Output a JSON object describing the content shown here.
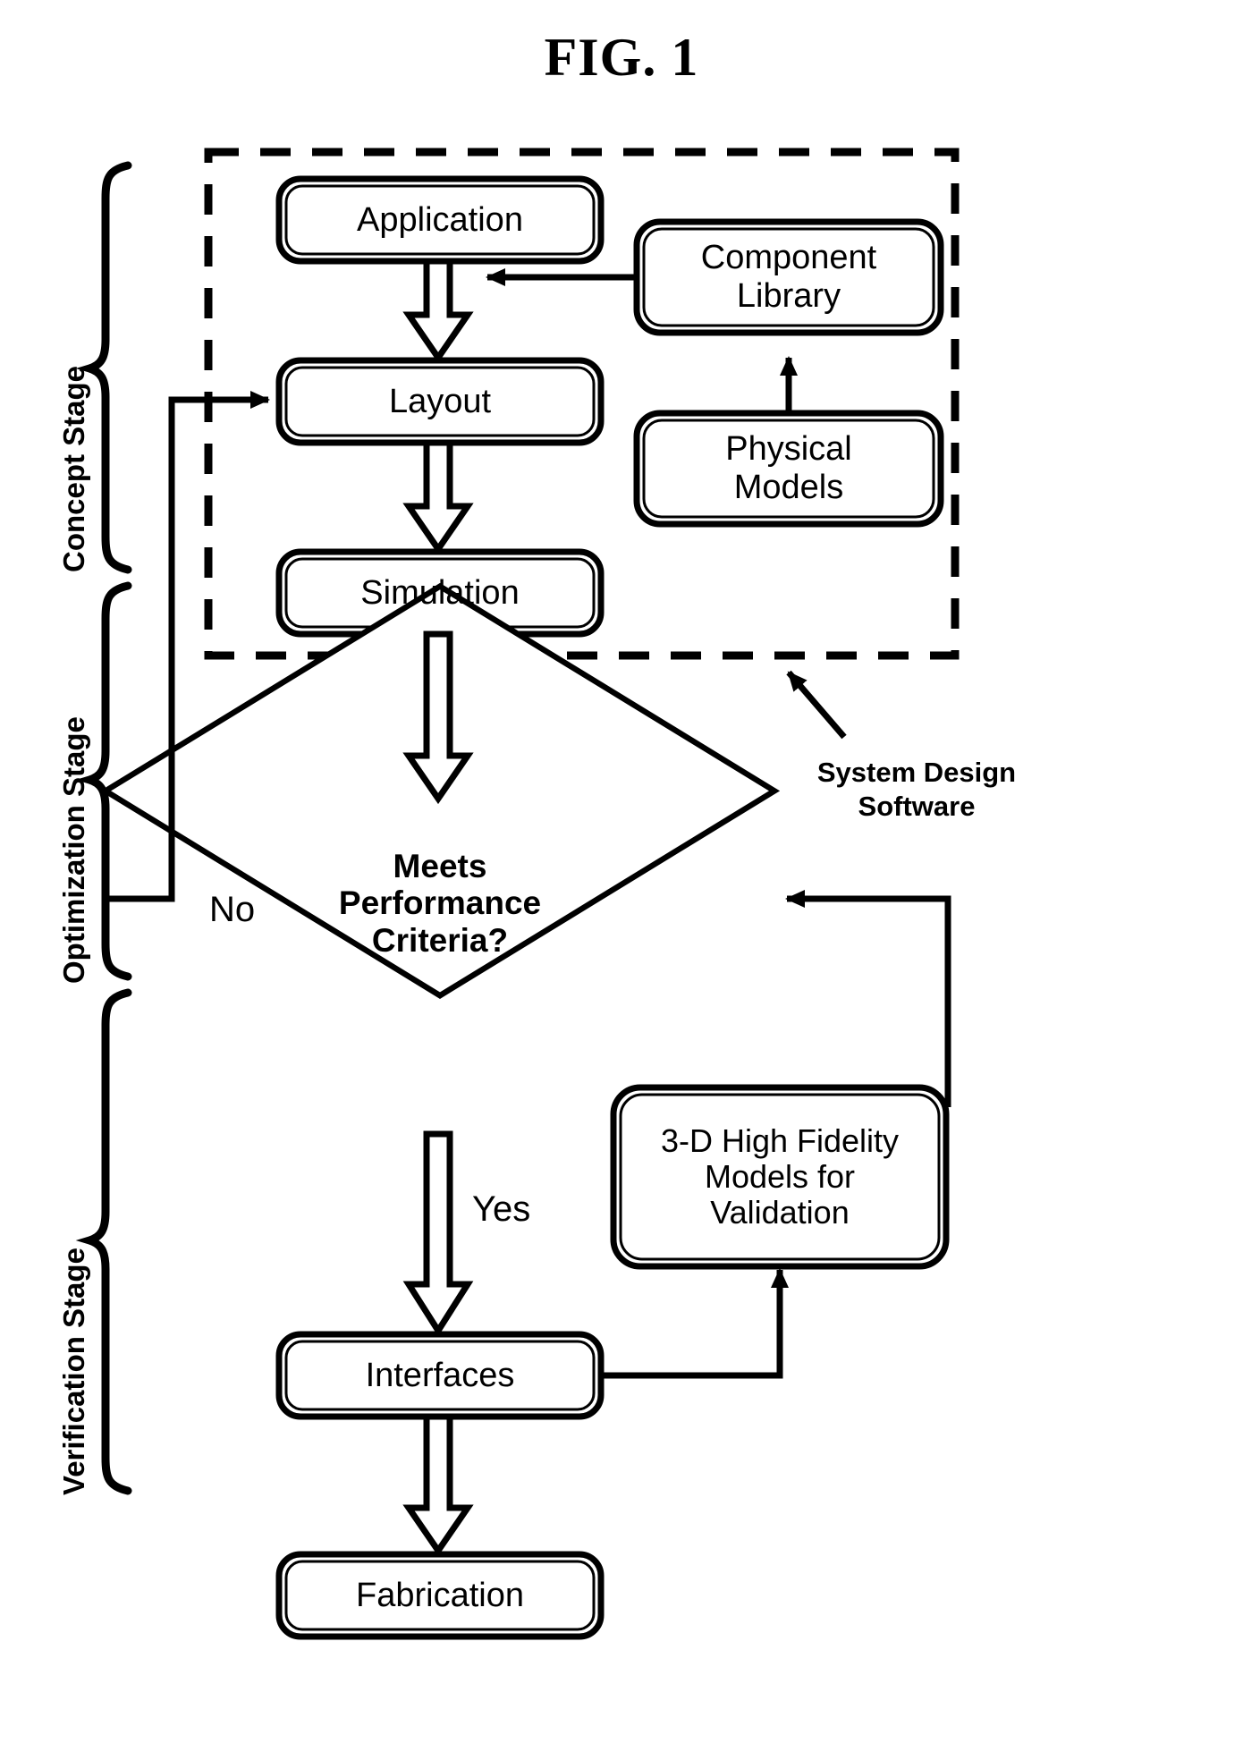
{
  "figure": {
    "title": "FIG. 1"
  },
  "stages": [
    {
      "label": "Concept Stage"
    },
    {
      "label": "Optimization Stage"
    },
    {
      "label": "Verification Stage"
    }
  ],
  "nodes": [
    {
      "id": "application",
      "label": "Application",
      "shape": "rounded-rect"
    },
    {
      "id": "component_library",
      "label": "Component\nLibrary",
      "shape": "rounded-rect"
    },
    {
      "id": "layout",
      "label": "Layout",
      "shape": "rounded-rect"
    },
    {
      "id": "physical_models",
      "label": "Physical\nModels",
      "shape": "rounded-rect"
    },
    {
      "id": "simulation",
      "label": "Simulation",
      "shape": "rounded-rect"
    },
    {
      "id": "decision",
      "label": "Meets\nPerformance\nCriteria?",
      "shape": "diamond"
    },
    {
      "id": "high_fidelity",
      "label": "3-D High Fidelity\nModels for\nValidation",
      "shape": "rounded-rect"
    },
    {
      "id": "interfaces",
      "label": "Interfaces",
      "shape": "rounded-rect"
    },
    {
      "id": "fabrication",
      "label": "Fabrication",
      "shape": "rounded-rect"
    }
  ],
  "edge_labels": [
    {
      "id": "no_label",
      "label": "No"
    },
    {
      "id": "yes_label",
      "label": "Yes"
    }
  ],
  "annotations": [
    {
      "id": "system_design_software",
      "label": "System Design\nSoftware"
    }
  ],
  "boundary": {
    "id": "system-design-software-boundary",
    "style": "dashed"
  },
  "colors": {
    "stroke": "#000000",
    "fill": "#ffffff",
    "background": "#ffffff"
  }
}
